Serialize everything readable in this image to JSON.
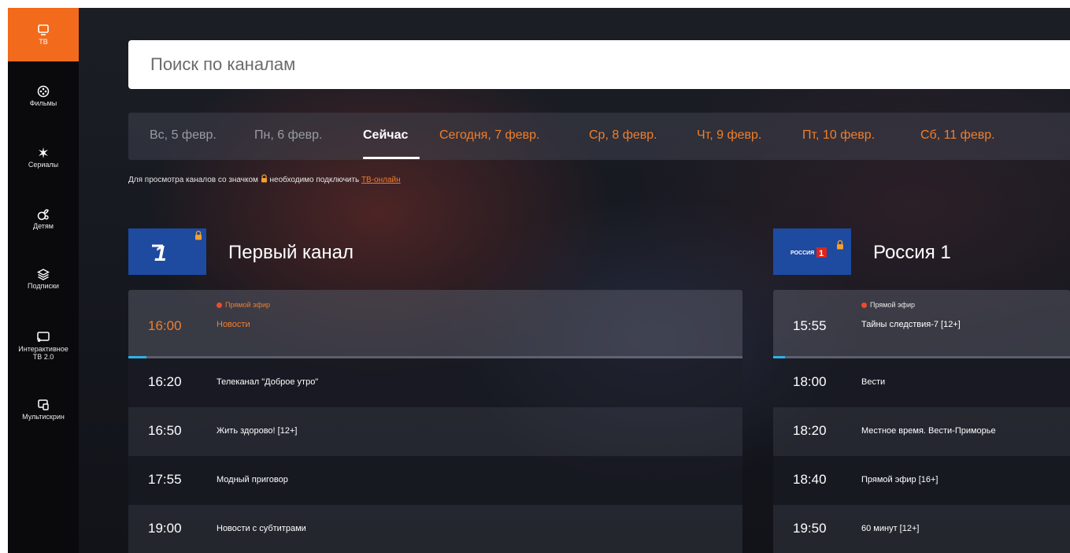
{
  "sidebar": {
    "items": [
      {
        "label": "ТВ",
        "icon": "tv-icon",
        "active": true
      },
      {
        "label": "Фильмы",
        "icon": "film-reel-icon"
      },
      {
        "label": "Сериалы",
        "icon": "series-icon"
      },
      {
        "label": "Детям",
        "icon": "kids-icon"
      },
      {
        "label": "Подписки",
        "icon": "layers-icon"
      },
      {
        "label": "Интерактивное\nТВ 2.0",
        "icon": "cast-icon"
      },
      {
        "label": "Мультискрин",
        "icon": "multiscreen-icon"
      }
    ]
  },
  "search": {
    "placeholder": "Поиск по каналам"
  },
  "dates": [
    {
      "label": "Вс, 5 февр.",
      "state": "past"
    },
    {
      "label": "Пн, 6 февр.",
      "state": "past"
    },
    {
      "label": "Сейчас",
      "state": "now"
    },
    {
      "label": "Сегодня, 7 февр.",
      "state": "future"
    },
    {
      "label": "Ср, 8 февр.",
      "state": "future"
    },
    {
      "label": "Чт, 9 февр.",
      "state": "future"
    },
    {
      "label": "Пт, 10 февр.",
      "state": "future"
    },
    {
      "label": "Сб, 11 февр.",
      "state": "future"
    }
  ],
  "notice": {
    "before": "Для просмотра каналов со значком",
    "after": "необходимо подключить",
    "link": "ТВ-онлайн"
  },
  "channels": [
    {
      "name": "Первый канал",
      "logo_text": "1",
      "live": {
        "badge": "Прямой эфир",
        "time": "16:00",
        "title": "Новости",
        "progress": 0.03
      },
      "schedule": [
        {
          "time": "16:20",
          "title": "Телеканал \"Доброе утро\""
        },
        {
          "time": "16:50",
          "title": "Жить здорово! [12+]"
        },
        {
          "time": "17:55",
          "title": "Модный приговор"
        },
        {
          "time": "19:00",
          "title": "Новости с субтитрами"
        }
      ]
    },
    {
      "name": "Россия 1",
      "logo_text": "РОССИЯ",
      "logo_number": "1",
      "live": {
        "badge": "Прямой эфир",
        "time": "15:55",
        "title": "Тайны следствия-7 [12+]",
        "progress": 0.04
      },
      "schedule": [
        {
          "time": "18:00",
          "title": "Вести"
        },
        {
          "time": "18:20",
          "title": "Местное время. Вести-Приморье"
        },
        {
          "time": "18:40",
          "title": "Прямой эфир [16+]"
        },
        {
          "time": "19:50",
          "title": "60 минут [12+]"
        }
      ]
    }
  ],
  "colors": {
    "accent": "#f26a1b",
    "future_date": "#f07f2c",
    "live_dot": "#f04a2a",
    "progress": "#2fb1e8",
    "logo_blue": "#1e4aa0"
  }
}
